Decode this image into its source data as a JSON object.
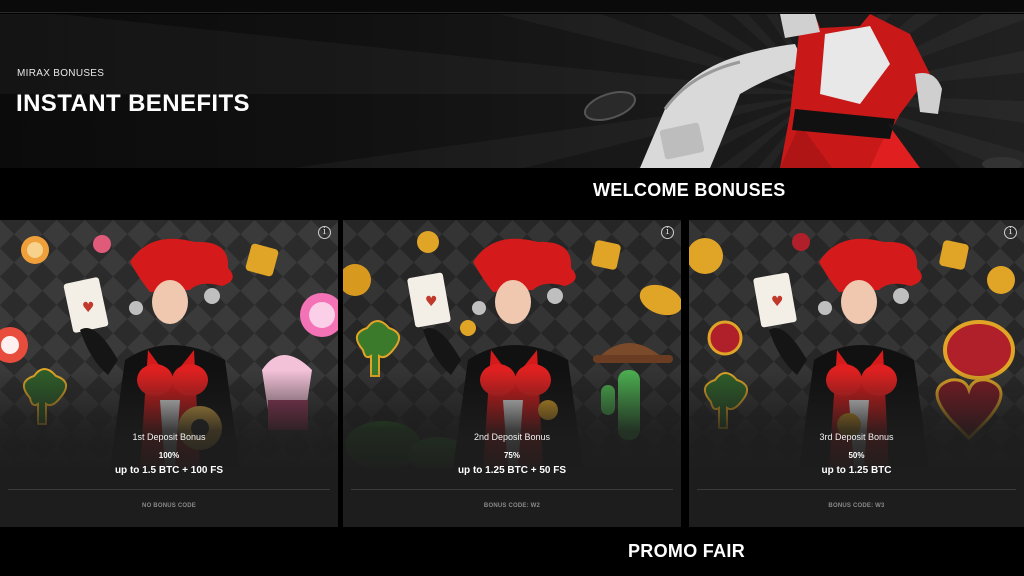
{
  "hero": {
    "eyebrow": "MIRAX BONUSES",
    "title": "INSTANT BENEFITS"
  },
  "sections": {
    "welcome_title": "WELCOME BONUSES",
    "promo_title": "PROMO FAIR"
  },
  "cards": [
    {
      "name": "1st Deposit Bonus",
      "percent": "100%",
      "amount": "up to 1.5 BTC + 100 FS",
      "code": "NO BONUS CODE",
      "info_icon": "info-icon"
    },
    {
      "name": "2nd Deposit Bonus",
      "percent": "75%",
      "amount": "up to 1.25 BTC + 50 FS",
      "code": "BONUS CODE: W2",
      "info_icon": "info-icon"
    },
    {
      "name": "3rd Deposit Bonus",
      "percent": "50%",
      "amount": "up to 1.25 BTC",
      "code": "BONUS CODE: W3",
      "info_icon": "info-icon"
    }
  ],
  "colors": {
    "jester_red": "#d41a1a",
    "gold": "#e0a526",
    "card_bg": "#1d1d1d",
    "page_bg": "#000000"
  }
}
